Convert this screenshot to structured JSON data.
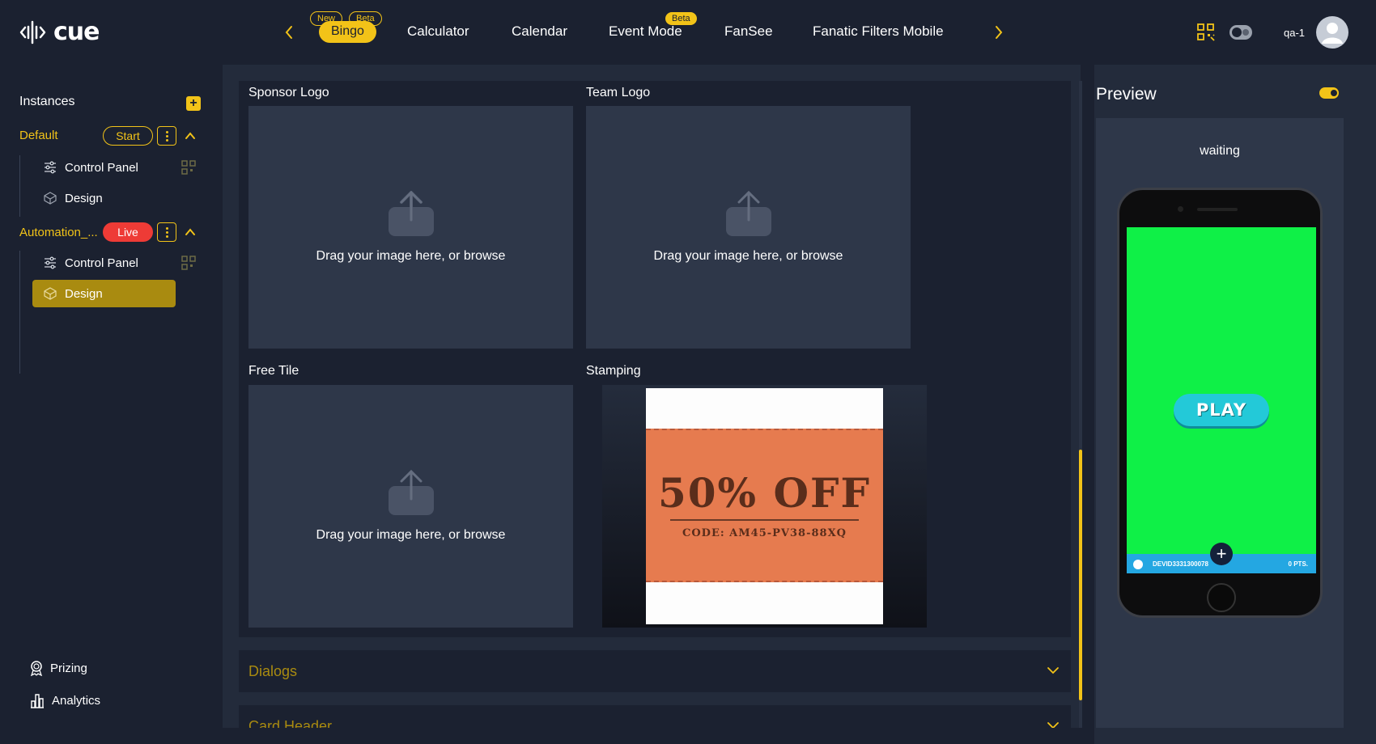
{
  "app": {
    "logo_text": "cue"
  },
  "nav": {
    "items": [
      {
        "label": "Bingo",
        "badges": [
          "New",
          "Beta"
        ],
        "active": true
      },
      {
        "label": "Calculator"
      },
      {
        "label": "Calendar"
      },
      {
        "label": "Event Mode",
        "badges": [
          "Beta"
        ]
      },
      {
        "label": "FanSee"
      },
      {
        "label": "Fanatic Filters Mobile"
      }
    ],
    "user": "qa-1"
  },
  "sidebar": {
    "title": "Instances",
    "add_symbol": "+",
    "instances": [
      {
        "name": "Default",
        "status": "Start",
        "children": [
          "Control Panel",
          "Design"
        ]
      },
      {
        "name": "Automation_...",
        "status": "Live",
        "children": [
          "Control Panel",
          "Design"
        ]
      }
    ],
    "bottom": [
      "Prizing",
      "Analytics"
    ]
  },
  "main": {
    "sections": {
      "sponsor_logo": "Sponsor Logo",
      "team_logo": "Team Logo",
      "free_tile": "Free Tile",
      "stamping": "Stamping"
    },
    "dropzone_text": "Drag your image here, or browse",
    "coupon": {
      "headline": "50% OFF",
      "code": "CODE: AM45-PV38-88XQ"
    },
    "accordions": [
      "Dialogs",
      "Card Header"
    ]
  },
  "preview": {
    "title": "Preview",
    "status": "waiting",
    "play_label": "PLAY",
    "device_id": "DEVID3331300078",
    "points": "0 PTS.",
    "plus_symbol": "+"
  },
  "colors": {
    "accent": "#f2c318",
    "live": "#ee3b36",
    "background": "#1b2130",
    "panel": "#2e3749",
    "phone_screen": "#0ff047"
  }
}
